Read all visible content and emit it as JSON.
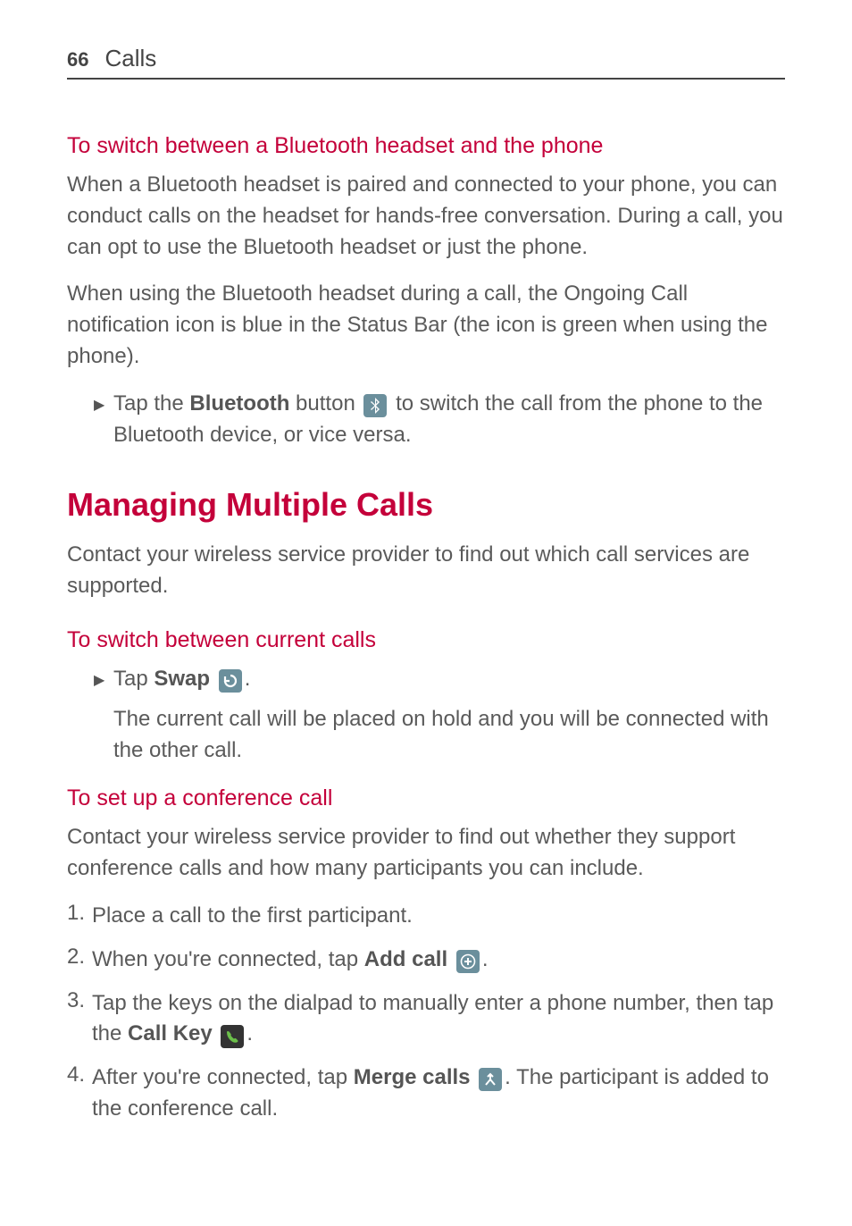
{
  "header": {
    "page_number": "66",
    "section_title": "Calls"
  },
  "section_bluetooth": {
    "heading": "To switch between a Bluetooth headset and the phone",
    "para1": "When a Bluetooth headset is paired and connected to your phone, you can conduct calls on the headset for hands-free conversation. During a call, you can opt to use the Bluetooth headset or just the phone.",
    "para2": "When using the Bluetooth headset during a call, the Ongoing Call notification icon is blue in the Status Bar (the icon is green when using the phone).",
    "bullet_pre": "Tap the ",
    "bullet_bold": "Bluetooth",
    "bullet_mid": " button ",
    "bullet_post": " to switch the call from the phone to the Bluetooth device, or vice versa."
  },
  "section_managing": {
    "heading": "Managing Multiple Calls",
    "para": "Contact your wireless service provider to find out which call services are supported."
  },
  "section_switch_current": {
    "heading": "To switch between current calls",
    "bullet_pre": "Tap ",
    "bullet_bold": "Swap",
    "bullet_post": ".",
    "result_text": "The current call will be placed on hold and you will be connected with the other call."
  },
  "section_conference": {
    "heading": "To set up a conference call",
    "para": "Contact your wireless service provider to find out whether they support conference calls and how many participants you can include.",
    "steps": {
      "s1_num": "1.",
      "s1_text": "Place a call to the first participant.",
      "s2_num": "2.",
      "s2_pre": "When you're connected, tap ",
      "s2_bold": "Add call",
      "s2_post": ".",
      "s3_num": "3.",
      "s3_pre": "Tap the keys on the dialpad to manually enter a phone number, then tap the ",
      "s3_bold": "Call Key",
      "s3_post": ".",
      "s4_num": "4.",
      "s4_pre": "After you're connected, tap ",
      "s4_bold": "Merge calls",
      "s4_post": ". The participant is added to the conference call."
    }
  },
  "icons": {
    "bluetooth": "bluetooth-icon",
    "swap": "swap-icon",
    "add_call": "add-call-icon",
    "call_key": "call-key-icon",
    "merge": "merge-calls-icon"
  }
}
